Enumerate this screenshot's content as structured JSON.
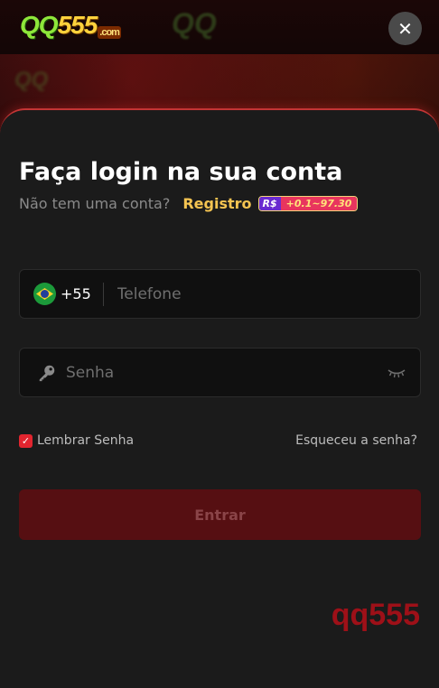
{
  "header": {
    "logo_q": "QQ",
    "logo_num": "555",
    "logo_com": ".com",
    "close_label": "✕"
  },
  "login": {
    "title": "Faça login na sua conta",
    "no_account": "Não tem uma conta?",
    "register_label": "Registro",
    "bonus_currency": "R$",
    "bonus_amount": "+0.1~97.30",
    "country_code": "+55",
    "phone_placeholder": "Telefone",
    "password_placeholder": "Senha",
    "remember_label": "Lembrar Senha",
    "forgot_label": "Esqueceu a senha?",
    "submit_label": "Entrar"
  },
  "watermark": "qq555",
  "colors": {
    "accent": "#e2252f",
    "register": "#f5c451",
    "button_bg": "#560f12"
  },
  "icons": [
    "brazil-flag-icon",
    "key-icon",
    "eye-closed-icon",
    "close-icon",
    "check-icon"
  ]
}
